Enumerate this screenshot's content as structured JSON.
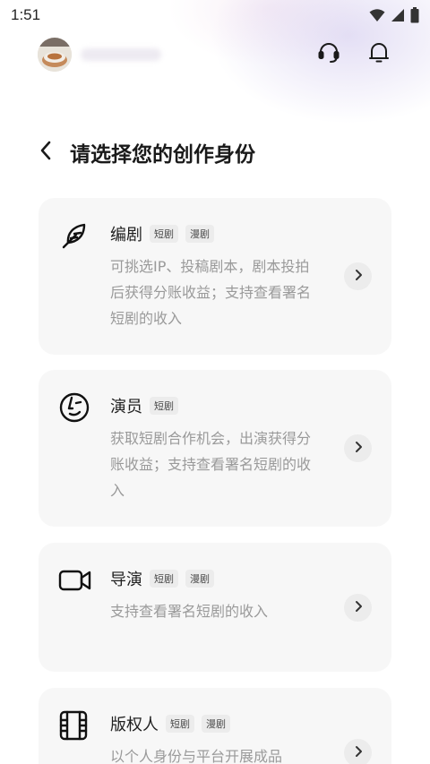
{
  "status_bar": {
    "time": "1:51"
  },
  "header": {
    "icons": [
      "headset-icon",
      "bell-icon"
    ]
  },
  "page": {
    "title": "请选择您的创作身份"
  },
  "roles": [
    {
      "title": "编剧",
      "tags": [
        "短剧",
        "漫剧"
      ],
      "description": "可挑选IP、投稿剧本，剧本投拍后获得分账收益；支持查看署名短剧的收入",
      "icon": "feather-pen-icon"
    },
    {
      "title": "演员",
      "tags": [
        "短剧"
      ],
      "description": "获取短剧合作机会，出演获得分账收益；支持查看署名短剧的收入",
      "icon": "face-icon"
    },
    {
      "title": "导演",
      "tags": [
        "短剧",
        "漫剧"
      ],
      "description": "支持查看署名短剧的收入",
      "icon": "video-camera-icon"
    },
    {
      "title": "版权人",
      "tags": [
        "短剧",
        "漫剧"
      ],
      "description": "以个人身份与平台开展成品",
      "icon": "film-icon"
    }
  ],
  "colors": {
    "card_bg": "#f7f7f7",
    "desc_text": "#9a9a9a",
    "tag_bg": "#ececec"
  }
}
